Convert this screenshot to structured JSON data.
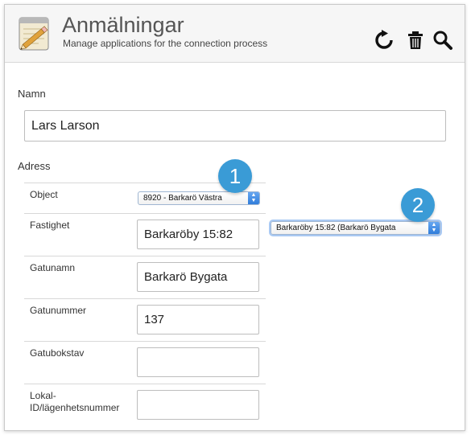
{
  "header": {
    "title": "Anmälningar",
    "subtitle": "Manage applications for the connection process",
    "icons": [
      "notepad-pencil-icon",
      "refresh-icon",
      "trash-icon",
      "search-icon"
    ]
  },
  "form": {
    "name_label": "Namn",
    "name_value": "Lars Larson",
    "address_label": "Adress",
    "rows": [
      {
        "label": "Object",
        "select_value": "8920 - Barkarö Västra"
      },
      {
        "label": "Fastighet",
        "value": "Barkaröby 15:82",
        "select_value": "Barkaröby 15:82 (Barkarö Bygata"
      },
      {
        "label": "Gatunamn",
        "value": "Barkarö Bygata"
      },
      {
        "label": "Gatunummer",
        "value": "137"
      },
      {
        "label": "Gatubokstav",
        "value": ""
      },
      {
        "label": "Lokal-ID/lägenhetsnummer",
        "value": ""
      }
    ]
  },
  "callouts": [
    "1",
    "2"
  ],
  "colors": {
    "badge": "#3a9bd6",
    "select_focus": "#a9c9f3"
  }
}
